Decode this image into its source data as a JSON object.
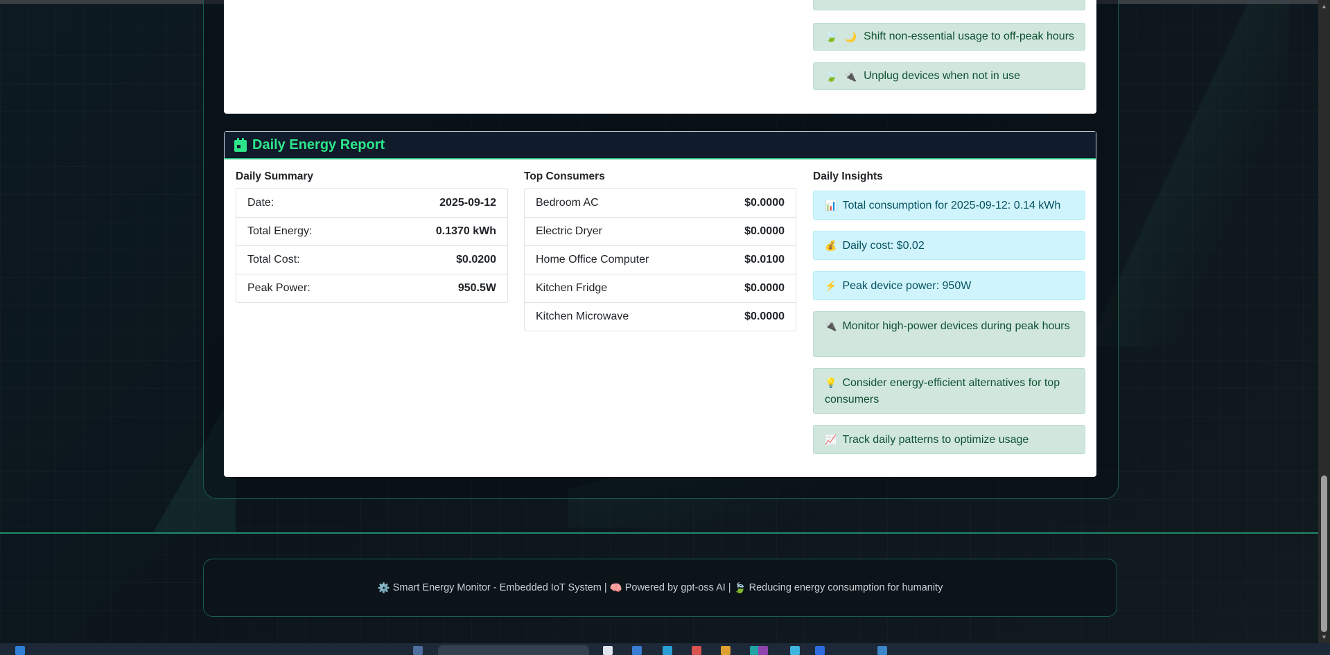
{
  "tips_top": [
    {
      "emoji": "🌙",
      "text": "Shift non-essential usage to off-peak hours"
    },
    {
      "emoji": "🔌",
      "text": "Unplug devices when not in use"
    }
  ],
  "report": {
    "title": "Daily Energy Report",
    "summary": {
      "title": "Daily Summary",
      "rows": [
        {
          "label": "Date:",
          "value": "2025-09-12"
        },
        {
          "label": "Total Energy:",
          "value": "0.1370 kWh"
        },
        {
          "label": "Total Cost:",
          "value": "$0.0200"
        },
        {
          "label": "Peak Power:",
          "value": "950.5W"
        }
      ]
    },
    "consumers": {
      "title": "Top Consumers",
      "rows": [
        {
          "label": "Bedroom AC",
          "value": "$0.0000"
        },
        {
          "label": "Electric Dryer",
          "value": "$0.0000"
        },
        {
          "label": "Home Office Computer",
          "value": "$0.0100"
        },
        {
          "label": "Kitchen Fridge",
          "value": "$0.0000"
        },
        {
          "label": "Kitchen Microwave",
          "value": "$0.0000"
        }
      ]
    },
    "insights": {
      "title": "Daily Insights",
      "items": [
        {
          "emoji": "📊",
          "text": "Total consumption for 2025-09-12: 0.14 kWh",
          "kind": "info"
        },
        {
          "emoji": "💰",
          "text": "Daily cost: $0.02",
          "kind": "info"
        },
        {
          "emoji": "⚡",
          "text": "Peak device power: 950W",
          "kind": "info"
        },
        {
          "emoji": "🔌",
          "text": "Monitor high-power devices during peak hours",
          "kind": "success"
        },
        {
          "emoji": "💡",
          "text": "Consider energy-efficient alternatives for top consumers",
          "kind": "success"
        },
        {
          "emoji": "📈",
          "text": "Track daily patterns to optimize usage",
          "kind": "success"
        }
      ]
    }
  },
  "footer": {
    "part1_icon": "⚙️",
    "part1": "Smart Energy Monitor - Embedded IoT System",
    "sep": "|",
    "part2_icon": "🧠",
    "part2": "Powered by gpt-oss AI",
    "part3_icon": "🍃",
    "part3": "Reducing energy consumption for humanity"
  },
  "colors": {
    "accent": "#2ee68a",
    "header_bg": "#101b2c",
    "info_bg": "#cff4fc",
    "success_bg": "#d1e7dd"
  },
  "icons": {
    "report": "calendar-icon",
    "tip": "leaf-icon"
  }
}
